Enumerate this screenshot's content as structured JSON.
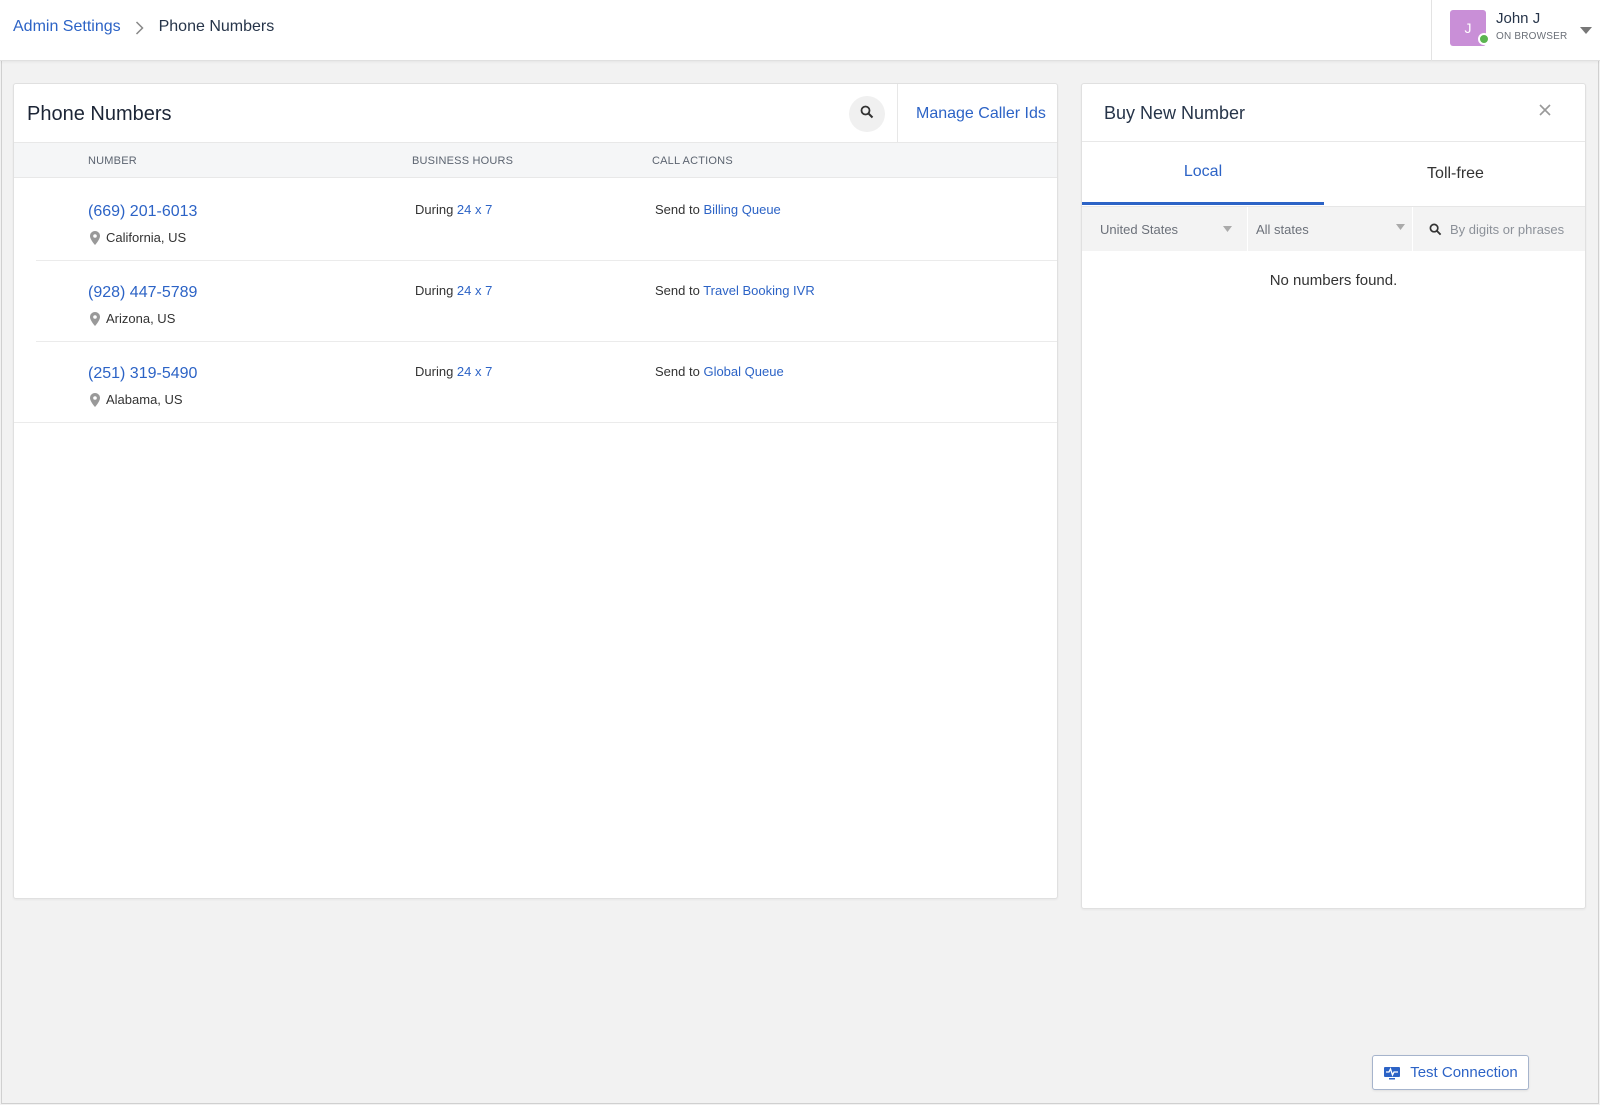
{
  "breadcrumb": {
    "parent": "Admin Settings",
    "current": "Phone Numbers"
  },
  "user": {
    "initial": "J",
    "name": "John J",
    "status": "ON BROWSER",
    "avatar_color": "#c98fd7",
    "status_color": "#5bb450"
  },
  "phone_numbers": {
    "title": "Phone Numbers",
    "manage_link": "Manage Caller Ids",
    "columns": [
      "NUMBER",
      "BUSINESS HOURS",
      "CALL ACTIONS"
    ],
    "rows": [
      {
        "number": "(669) 201-6013",
        "location": "California, US",
        "hours_prefix": "During",
        "hours": "24 x 7",
        "action_prefix": "Send to",
        "action_target": "Billing Queue"
      },
      {
        "number": "(928) 447-5789",
        "location": "Arizona, US",
        "hours_prefix": "During",
        "hours": "24 x 7",
        "action_prefix": "Send to",
        "action_target": "Travel Booking IVR"
      },
      {
        "number": "(251) 319-5490",
        "location": "Alabama, US",
        "hours_prefix": "During",
        "hours": "24 x 7",
        "action_prefix": "Send to",
        "action_target": "Global Queue"
      }
    ]
  },
  "buy_panel": {
    "title": "Buy New Number",
    "tabs": [
      {
        "label": "Local",
        "active": true
      },
      {
        "label": "Toll-free",
        "active": false
      }
    ],
    "country_selected": "United States",
    "state_selected": "All states",
    "search_placeholder": "By digits or phrases",
    "empty_message": "No numbers found."
  },
  "footer": {
    "test_connection": "Test Connection"
  },
  "colors": {
    "link": "#2c63c6",
    "background": "#f2f2f2"
  }
}
